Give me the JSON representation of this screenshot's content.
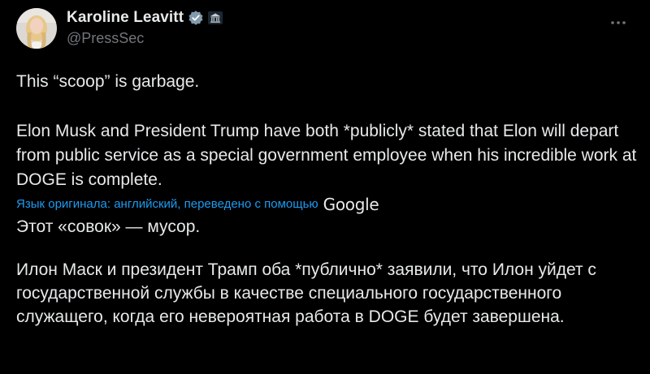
{
  "author": {
    "display_name": "Karoline Leavitt",
    "handle": "@PressSec",
    "verified_badge_icon": "verified-check-icon",
    "affiliation_badge_icon": "government-building-icon",
    "avatar": "profile-photo"
  },
  "menu": {
    "icon": "more-dots-icon",
    "glyph": "···"
  },
  "tweet": {
    "line_1": "This “scoop” is garbage.",
    "line_2": "Elon Musk and President Trump have both *publicly* stated that Elon will depart from public service as a special government employee when his incredible work at DOGE is complete."
  },
  "translation": {
    "notice": "Язык оригинала: английский, переведено с помощью",
    "provider": "Google",
    "line_1": "Этот «совок» — мусор.",
    "line_2": "Илон Маск и президент Трамп оба *публично* заявили, что Илон уйдет с государственной службы в качестве специального государственного служащего, когда его невероятная работа в DOGE будет завершена."
  },
  "colors": {
    "background": "#000000",
    "text": "#e7e9ea",
    "secondary": "#71767b",
    "link": "#1d9bf0",
    "verified": "#1d9bf0"
  }
}
